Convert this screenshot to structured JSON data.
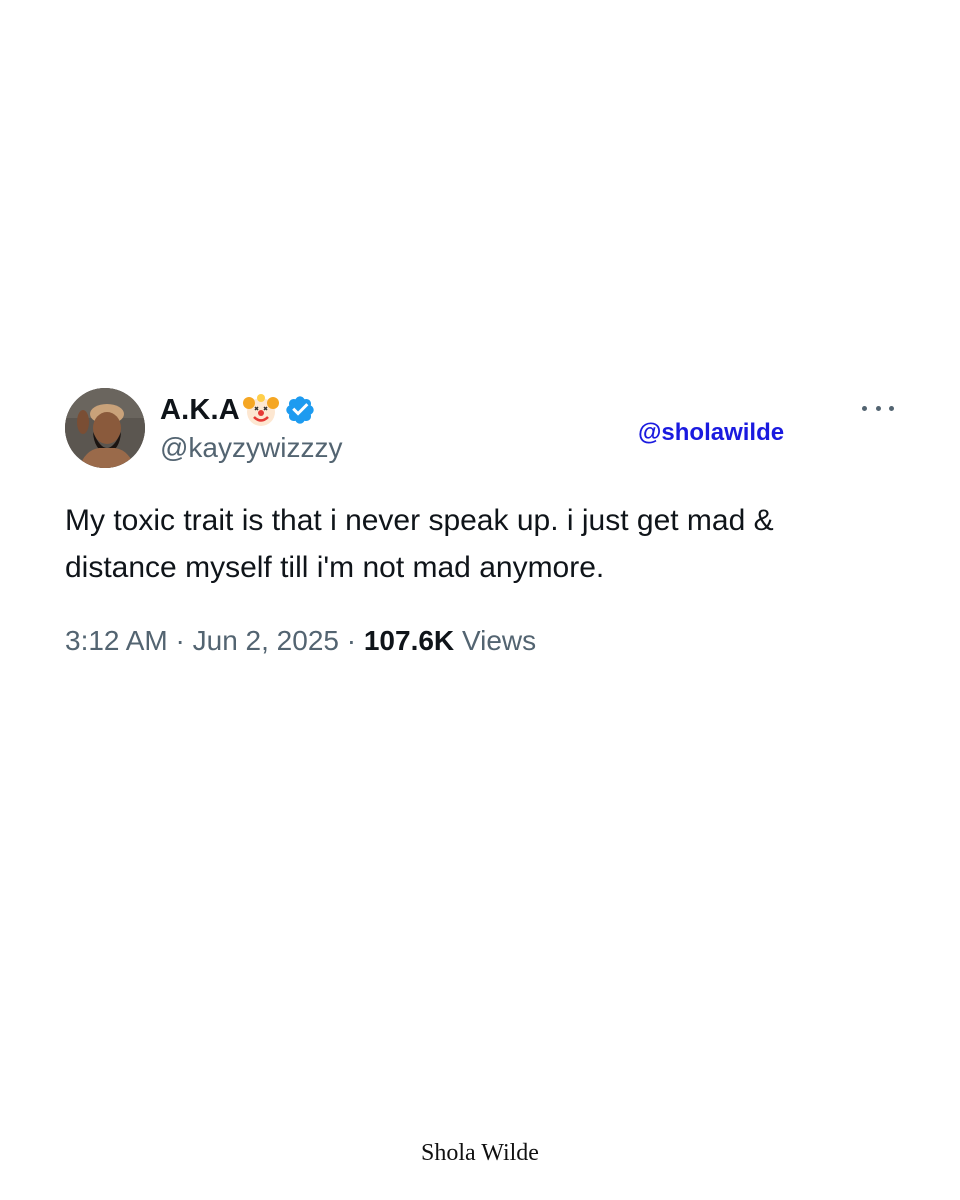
{
  "tweet": {
    "author": {
      "display_name": "A.K.A",
      "name_emoji": "clown-face",
      "verified": true,
      "handle": "@kayzywizzzy"
    },
    "text_lines": [
      "My toxic trait is that i never speak up. i just get mad &",
      "distance myself till i'm not mad anymore."
    ],
    "meta": {
      "time": "3:12 AM",
      "separator": "·",
      "date": "Jun 2, 2025",
      "views_count": "107.6K",
      "views_label": "Views"
    }
  },
  "watermark": {
    "handle": "@sholawilde",
    "signature": "Shola Wilde"
  },
  "colors": {
    "text_primary": "#0f1419",
    "text_secondary": "#536471",
    "verified_blue": "#1d9bf0",
    "watermark_blue": "#1a1adf"
  },
  "icons": {
    "more": "more-horizontal-icon",
    "verified": "verified-badge-icon",
    "emoji": "clown-face-icon"
  }
}
